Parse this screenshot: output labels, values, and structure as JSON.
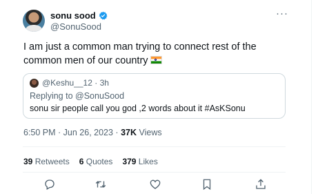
{
  "tweet": {
    "display_name": "sonu sood",
    "handle": "@SonuSood",
    "text": "I am just a common man trying to connect rest of the common men of our country",
    "flag_icon": "india-flag-icon",
    "more_label": "···"
  },
  "quote": {
    "handle": "@Keshu__12 · 3h",
    "replying_to_label": "Replying to ",
    "replying_to_handle": "@SonuSood",
    "text": "sonu sir people call you god ,2 words about it #AsKSonu"
  },
  "meta": {
    "time_date": "6:50 PM · Jun 26, 2023 · ",
    "views_count": "37K",
    "views_label": " Views"
  },
  "stats": {
    "retweets_count": "39",
    "retweets_label": " Retweets",
    "quotes_count": "6",
    "quotes_label": " Quotes",
    "likes_count": "379",
    "likes_label": " Likes"
  },
  "actions": [
    "reply-icon",
    "retweet-icon",
    "like-icon",
    "bookmark-icon",
    "share-icon"
  ],
  "colors": {
    "verified": "#1d9bf0",
    "secondary_text": "#536471",
    "border": "#cfd9de"
  }
}
